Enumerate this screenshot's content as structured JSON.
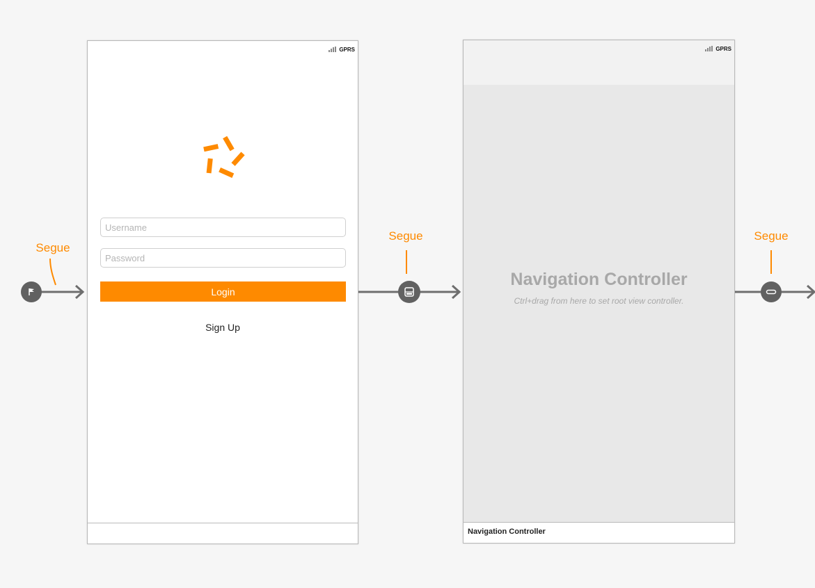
{
  "colors": {
    "accent": "#fe8a00",
    "segue_line": "#6e6e6e",
    "canvas": "#f6f6f6",
    "nav_body": "#e8e8e8",
    "nav_text": "#a8a8a8"
  },
  "segue_labels": [
    "Segue",
    "Segue",
    "Segue"
  ],
  "login_scene": {
    "status": {
      "carrier": "GPRS",
      "icon": "signal-bars-icon"
    },
    "logo_icon": "pinwheel-logo-icon",
    "username_placeholder": "Username",
    "password_placeholder": "Password",
    "login_label": "Login",
    "signup_label": "Sign Up"
  },
  "nav_scene": {
    "status": {
      "carrier": "GPRS",
      "icon": "signal-bars-icon"
    },
    "title": "Navigation Controller",
    "hint": "Ctrl+drag from here to set root view controller.",
    "footer_label": "Navigation Controller"
  },
  "segue_icons": [
    "entry-point-flag-icon",
    "present-modally-segue-icon",
    "root-relationship-segue-icon"
  ]
}
